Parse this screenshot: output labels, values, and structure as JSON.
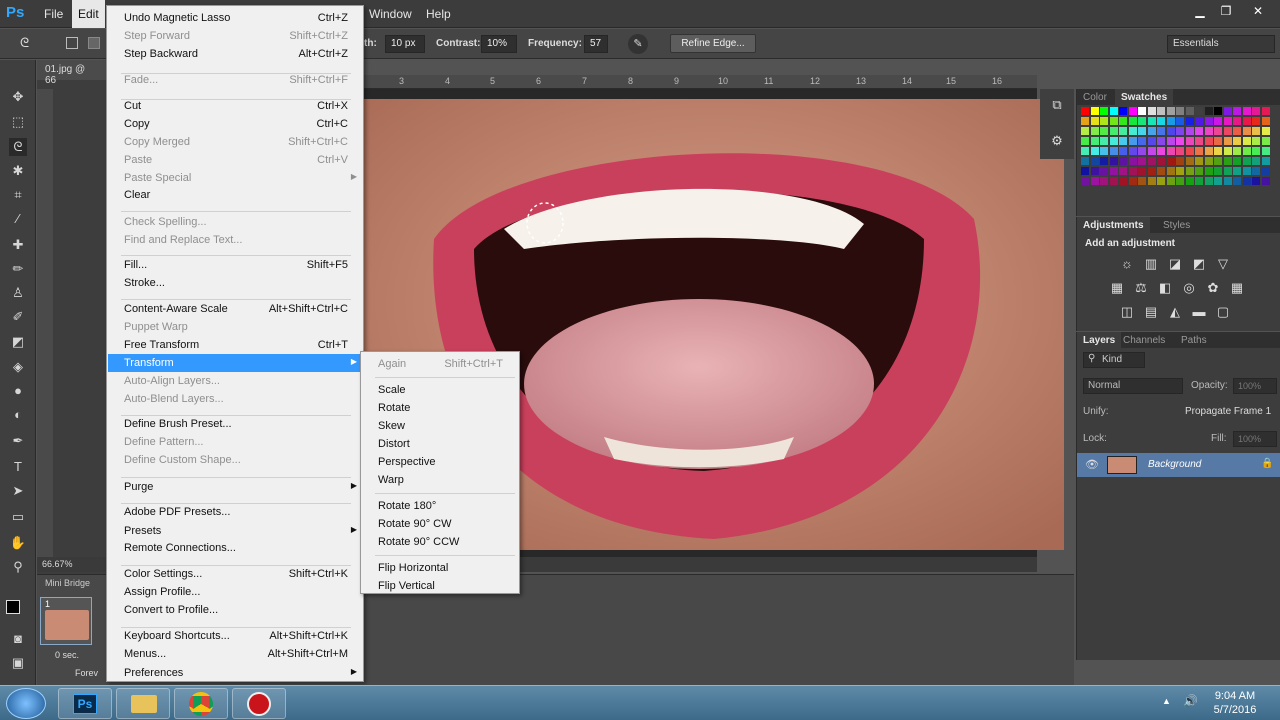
{
  "menubar": {
    "app_logo": "Ps",
    "items": [
      "File",
      "Edit",
      "Window",
      "Help"
    ]
  },
  "options": {
    "width_label": "th:",
    "width_value": "10 px",
    "contrast_label": "Contrast:",
    "contrast_value": "10%",
    "frequency_label": "Frequency:",
    "frequency_value": "57",
    "refine_edge": "Refine Edge...",
    "workspace": "Essentials"
  },
  "document": {
    "tab_title": "01.jpg @ 66",
    "zoom": "66.67%",
    "ruler_ticks": [
      "3",
      "4",
      "5",
      "6",
      "7",
      "8",
      "9",
      "10",
      "11",
      "12",
      "13",
      "14",
      "15",
      "16"
    ]
  },
  "mini_bridge": {
    "title": "Mini Bridge",
    "frame_number": "1",
    "frame_delay": "0 sec.",
    "loop": "Forev"
  },
  "edit_menu": [
    {
      "label": "Undo Magnetic Lasso",
      "shortcut": "Ctrl+Z",
      "disabled": false
    },
    {
      "label": "Step Forward",
      "shortcut": "Shift+Ctrl+Z",
      "disabled": true
    },
    {
      "label": "Step Backward",
      "shortcut": "Alt+Ctrl+Z",
      "disabled": false
    },
    {
      "label": "Fade...",
      "shortcut": "Shift+Ctrl+F",
      "disabled": true
    },
    {
      "label": "Cut",
      "shortcut": "Ctrl+X",
      "disabled": false
    },
    {
      "label": "Copy",
      "shortcut": "Ctrl+C",
      "disabled": false
    },
    {
      "label": "Copy Merged",
      "shortcut": "Shift+Ctrl+C",
      "disabled": true
    },
    {
      "label": "Paste",
      "shortcut": "Ctrl+V",
      "disabled": true
    },
    {
      "label": "Paste Special",
      "shortcut": "",
      "disabled": true,
      "submenu": true
    },
    {
      "label": "Clear",
      "shortcut": "",
      "disabled": false
    },
    {
      "label": "Check Spelling...",
      "shortcut": "",
      "disabled": true
    },
    {
      "label": "Find and Replace Text...",
      "shortcut": "",
      "disabled": true
    },
    {
      "label": "Fill...",
      "shortcut": "Shift+F5",
      "disabled": false
    },
    {
      "label": "Stroke...",
      "shortcut": "",
      "disabled": false
    },
    {
      "label": "Content-Aware Scale",
      "shortcut": "Alt+Shift+Ctrl+C",
      "disabled": false
    },
    {
      "label": "Puppet Warp",
      "shortcut": "",
      "disabled": true
    },
    {
      "label": "Free Transform",
      "shortcut": "Ctrl+T",
      "disabled": false
    },
    {
      "label": "Transform",
      "shortcut": "",
      "disabled": false,
      "submenu": true,
      "highlighted": true
    },
    {
      "label": "Auto-Align Layers...",
      "shortcut": "",
      "disabled": true
    },
    {
      "label": "Auto-Blend Layers...",
      "shortcut": "",
      "disabled": true
    },
    {
      "label": "Define Brush Preset...",
      "shortcut": "",
      "disabled": false
    },
    {
      "label": "Define Pattern...",
      "shortcut": "",
      "disabled": true
    },
    {
      "label": "Define Custom Shape...",
      "shortcut": "",
      "disabled": true
    },
    {
      "label": "Purge",
      "shortcut": "",
      "disabled": false,
      "submenu": true
    },
    {
      "label": "Adobe PDF Presets...",
      "shortcut": "",
      "disabled": false
    },
    {
      "label": "Presets",
      "shortcut": "",
      "disabled": false,
      "submenu": true
    },
    {
      "label": "Remote Connections...",
      "shortcut": "",
      "disabled": false
    },
    {
      "label": "Color Settings...",
      "shortcut": "Shift+Ctrl+K",
      "disabled": false
    },
    {
      "label": "Assign Profile...",
      "shortcut": "",
      "disabled": false
    },
    {
      "label": "Convert to Profile...",
      "shortcut": "",
      "disabled": false
    },
    {
      "label": "Keyboard Shortcuts...",
      "shortcut": "Alt+Shift+Ctrl+K",
      "disabled": false
    },
    {
      "label": "Menus...",
      "shortcut": "Alt+Shift+Ctrl+M",
      "disabled": false
    },
    {
      "label": "Preferences",
      "shortcut": "",
      "disabled": false,
      "submenu": true
    }
  ],
  "transform_submenu": [
    {
      "label": "Again",
      "shortcut": "Shift+Ctrl+T",
      "disabled": true
    },
    {
      "label": "Scale",
      "shortcut": "",
      "disabled": false
    },
    {
      "label": "Rotate",
      "shortcut": "",
      "disabled": false
    },
    {
      "label": "Skew",
      "shortcut": "",
      "disabled": false
    },
    {
      "label": "Distort",
      "shortcut": "",
      "disabled": false
    },
    {
      "label": "Perspective",
      "shortcut": "",
      "disabled": false
    },
    {
      "label": "Warp",
      "shortcut": "",
      "disabled": false
    },
    {
      "label": "Rotate 180°",
      "shortcut": "",
      "disabled": false
    },
    {
      "label": "Rotate 90° CW",
      "shortcut": "",
      "disabled": false
    },
    {
      "label": "Rotate 90° CCW",
      "shortcut": "",
      "disabled": false
    },
    {
      "label": "Flip Horizontal",
      "shortcut": "",
      "disabled": false
    },
    {
      "label": "Flip Vertical",
      "shortcut": "",
      "disabled": false
    }
  ],
  "panels": {
    "color_tab": "Color",
    "swatches_tab": "Swatches",
    "adjustments_tab": "Adjustments",
    "styles_tab": "Styles",
    "add_adjustment": "Add an adjustment",
    "layers_tab": "Layers",
    "channels_tab": "Channels",
    "paths_tab": "Paths",
    "kind_filter": "Kind",
    "blend_mode": "Normal",
    "opacity_label": "Opacity:",
    "opacity_value": "100%",
    "unify_label": "Unify:",
    "propagate_label": "Propagate Frame 1",
    "lock_label": "Lock:",
    "fill_label": "Fill:",
    "fill_value": "100%",
    "layer_name": "Background"
  },
  "taskbar": {
    "time": "9:04 AM",
    "date": "5/7/2016",
    "ps_label": "Ps"
  }
}
